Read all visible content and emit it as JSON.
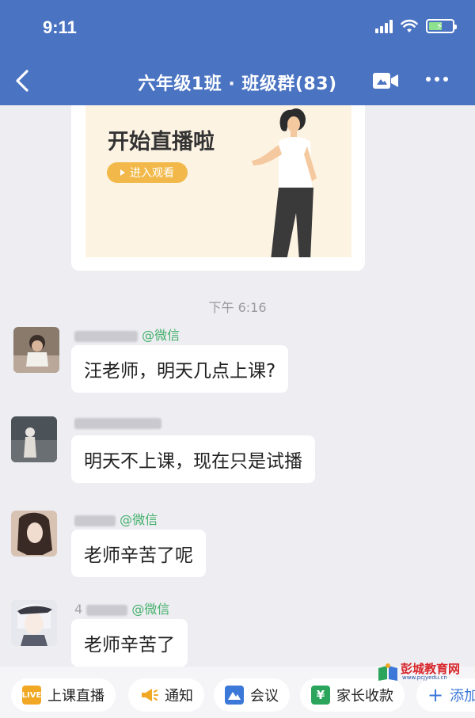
{
  "status_bar": {
    "time": "9:11"
  },
  "header": {
    "title": "六年级1班 · 班级群(83)"
  },
  "live_card": {
    "title": "开始直播啦",
    "button": "进入观看"
  },
  "timestamp": "下午 6:16",
  "messages": [
    {
      "sender_suffix": "@微信",
      "text": "汪老师，明天几点上课?"
    },
    {
      "sender_suffix": "",
      "text": "明天不上课，现在只是试播"
    },
    {
      "sender_suffix": "@微信",
      "text": "老师辛苦了呢"
    },
    {
      "sender_prefix": "4",
      "sender_suffix": "@微信",
      "text": "老师辛苦了"
    }
  ],
  "bottom_bar": {
    "items": [
      {
        "icon": "live-icon",
        "icon_text": "LIVE",
        "label": "上课直播"
      },
      {
        "icon": "megaphone-icon",
        "label": "通知"
      },
      {
        "icon": "meeting-icon",
        "label": "会议"
      },
      {
        "icon": "yuan-icon",
        "icon_text": "¥",
        "label": "家长收款"
      },
      {
        "icon": "plus-icon",
        "label": "添加"
      }
    ]
  },
  "watermark": {
    "text": "彭城教育网",
    "url": "www.pcjyedu.cn"
  },
  "colors": {
    "header": "#4a73c2",
    "wechat": "#44b06a",
    "live": "#f0a825"
  }
}
